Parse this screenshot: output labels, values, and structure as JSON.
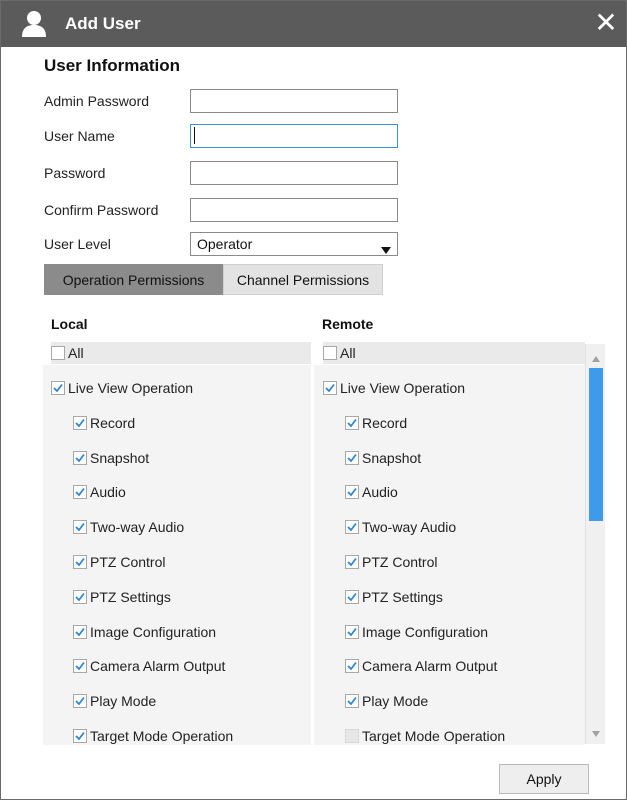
{
  "dialog": {
    "title": "Add User",
    "icons": {
      "title": "user-icon",
      "close": "close-icon"
    },
    "close_symbol": "✕"
  },
  "user_info": {
    "heading": "User Information",
    "fields": {
      "admin_password": {
        "label": "Admin Password",
        "value": ""
      },
      "user_name": {
        "label": "User Name",
        "value": ""
      },
      "password": {
        "label": "Password",
        "value": ""
      },
      "confirm_password": {
        "label": "Confirm Password",
        "value": ""
      }
    },
    "user_level": {
      "label": "User Level",
      "value": "Operator"
    }
  },
  "tabs": [
    {
      "label": "Operation Permissions",
      "active": true
    },
    {
      "label": "Channel Permissions",
      "active": false
    }
  ],
  "permissions": {
    "local": {
      "header": "Local",
      "all": {
        "label": "All",
        "checked": false
      },
      "items": [
        {
          "label": "Live View Operation",
          "checked": true,
          "level": 0
        },
        {
          "label": "Record",
          "checked": true,
          "level": 1
        },
        {
          "label": "Snapshot",
          "checked": true,
          "level": 1
        },
        {
          "label": "Audio",
          "checked": true,
          "level": 1
        },
        {
          "label": "Two-way Audio",
          "checked": true,
          "level": 1
        },
        {
          "label": "PTZ Control",
          "checked": true,
          "level": 1
        },
        {
          "label": "PTZ Settings",
          "checked": true,
          "level": 1
        },
        {
          "label": "Image Configuration",
          "checked": true,
          "level": 1
        },
        {
          "label": "Camera Alarm Output",
          "checked": true,
          "level": 1
        },
        {
          "label": "Play Mode",
          "checked": true,
          "level": 1
        },
        {
          "label": "Target Mode Operation",
          "checked": true,
          "level": 1
        }
      ]
    },
    "remote": {
      "header": "Remote",
      "all": {
        "label": "All",
        "checked": false
      },
      "items": [
        {
          "label": "Live View Operation",
          "checked": true,
          "level": 0
        },
        {
          "label": "Record",
          "checked": true,
          "level": 1
        },
        {
          "label": "Snapshot",
          "checked": true,
          "level": 1
        },
        {
          "label": "Audio",
          "checked": true,
          "level": 1
        },
        {
          "label": "Two-way Audio",
          "checked": true,
          "level": 1
        },
        {
          "label": "PTZ Control",
          "checked": true,
          "level": 1
        },
        {
          "label": "PTZ Settings",
          "checked": true,
          "level": 1
        },
        {
          "label": "Image Configuration",
          "checked": true,
          "level": 1
        },
        {
          "label": "Camera Alarm Output",
          "checked": true,
          "level": 1
        },
        {
          "label": "Play Mode",
          "checked": true,
          "level": 1
        },
        {
          "label": "Target Mode Operation",
          "checked": false,
          "disabled": true,
          "level": 1
        }
      ]
    }
  },
  "apply_label": "Apply",
  "colors": {
    "titlebar": "#5b5b5b",
    "check": "#2f86d6",
    "scroll_thumb": "#3d9be9",
    "active_tab": "#8b8b8b"
  }
}
